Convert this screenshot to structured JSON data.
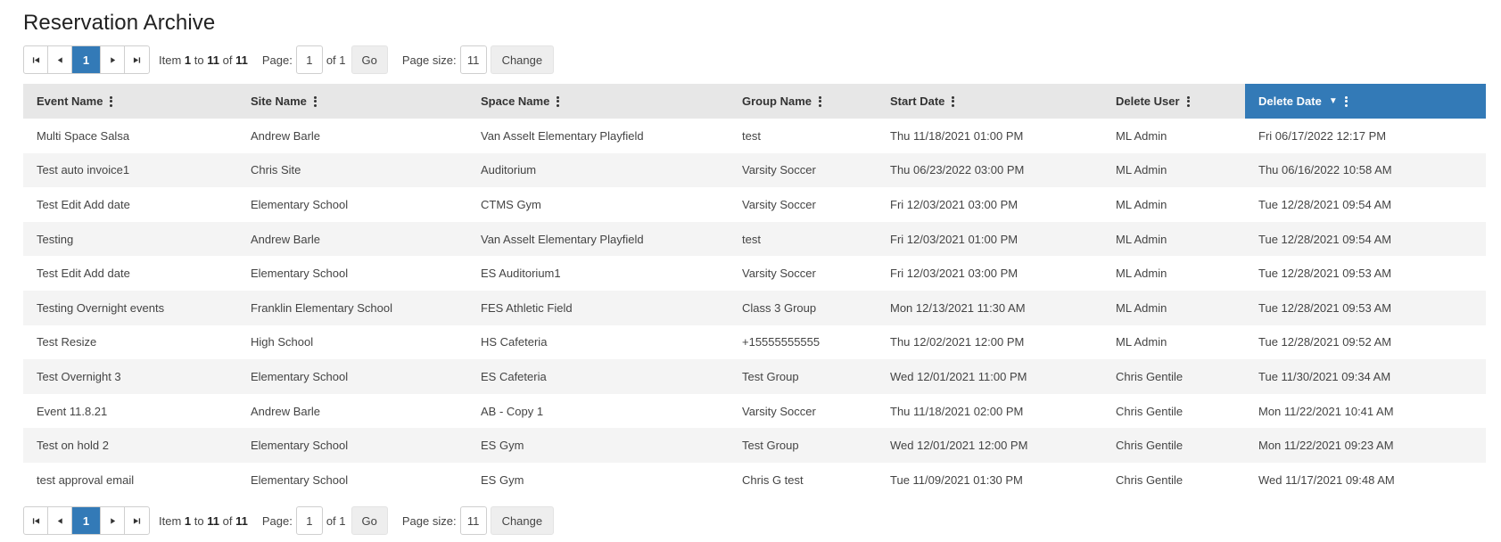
{
  "page": {
    "title": "Reservation Archive"
  },
  "pager": {
    "current_page": "1",
    "item_prefix": "Item",
    "item_from": "1",
    "item_to_word": "to",
    "item_to": "11",
    "item_of_word": "of",
    "item_total": "11",
    "page_label": "Page:",
    "page_value": "1",
    "of_pages": "of 1",
    "go_label": "Go",
    "page_size_label": "Page size:",
    "page_size_value": "11",
    "change_label": "Change"
  },
  "table": {
    "columns": [
      {
        "label": "Event Name"
      },
      {
        "label": "Site Name"
      },
      {
        "label": "Space Name"
      },
      {
        "label": "Group Name"
      },
      {
        "label": "Start Date"
      },
      {
        "label": "Delete User"
      },
      {
        "label": "Delete Date",
        "sorted": "descending"
      }
    ],
    "rows": [
      [
        "Multi Space Salsa",
        "Andrew Barle",
        "Van Asselt Elementary Playfield",
        "test",
        "Thu 11/18/2021 01:00 PM",
        "ML Admin",
        "Fri 06/17/2022 12:17 PM"
      ],
      [
        "Test auto invoice1",
        "Chris Site",
        "Auditorium",
        "Varsity Soccer",
        "Thu 06/23/2022 03:00 PM",
        "ML Admin",
        "Thu 06/16/2022 10:58 AM"
      ],
      [
        "Test Edit Add date",
        "Elementary School",
        "CTMS Gym",
        "Varsity Soccer",
        "Fri 12/03/2021 03:00 PM",
        "ML Admin",
        "Tue 12/28/2021 09:54 AM"
      ],
      [
        "Testing",
        "Andrew Barle",
        "Van Asselt Elementary Playfield",
        "test",
        "Fri 12/03/2021 01:00 PM",
        "ML Admin",
        "Tue 12/28/2021 09:54 AM"
      ],
      [
        "Test Edit Add date",
        "Elementary School",
        "ES Auditorium1",
        "Varsity Soccer",
        "Fri 12/03/2021 03:00 PM",
        "ML Admin",
        "Tue 12/28/2021 09:53 AM"
      ],
      [
        "Testing Overnight events",
        "Franklin Elementary School",
        "FES Athletic Field",
        "Class 3 Group",
        "Mon 12/13/2021 11:30 AM",
        "ML Admin",
        "Tue 12/28/2021 09:53 AM"
      ],
      [
        "Test Resize",
        "High School",
        "HS Cafeteria",
        "+15555555555",
        "Thu 12/02/2021 12:00 PM",
        "ML Admin",
        "Tue 12/28/2021 09:52 AM"
      ],
      [
        "Test Overnight 3",
        "Elementary School",
        "ES Cafeteria",
        "Test Group",
        "Wed 12/01/2021 11:00 PM",
        "Chris Gentile",
        "Tue 11/30/2021 09:34 AM"
      ],
      [
        "Event 11.8.21",
        "Andrew Barle",
        "AB - Copy 1",
        "Varsity Soccer",
        "Thu 11/18/2021 02:00 PM",
        "Chris Gentile",
        "Mon 11/22/2021 10:41 AM"
      ],
      [
        "Test on hold 2",
        "Elementary School",
        "ES Gym",
        "Test Group",
        "Wed 12/01/2021 12:00 PM",
        "Chris Gentile",
        "Mon 11/22/2021 09:23 AM"
      ],
      [
        "test approval email",
        "Elementary School",
        "ES Gym",
        "Chris G test",
        "Tue 11/09/2021 01:30 PM",
        "Chris Gentile",
        "Wed 11/17/2021 09:48 AM"
      ]
    ]
  },
  "icons": {
    "first": "first-page-icon",
    "prev": "previous-page-icon",
    "next": "next-page-icon",
    "last": "last-page-icon",
    "column_menu": "column-menu-icon",
    "sort_desc": "sort-descending-icon"
  },
  "colors": {
    "accent": "#337ab7",
    "header_bg": "#e7e7e7",
    "stripe": "#f4f4f4"
  }
}
